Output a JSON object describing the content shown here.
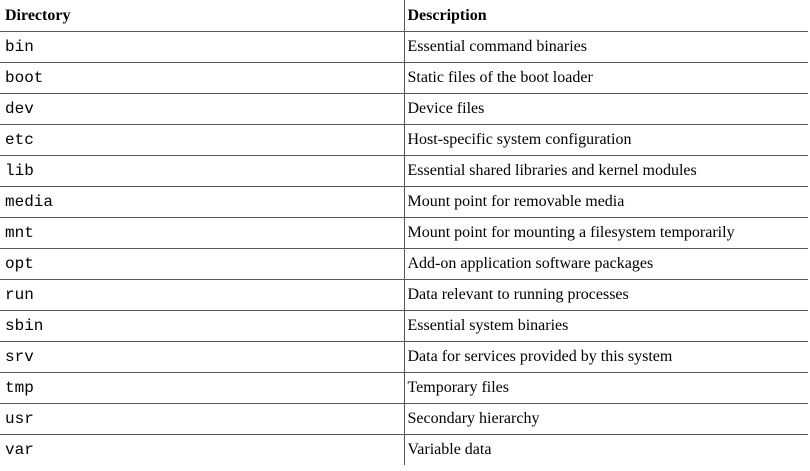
{
  "table": {
    "headers": {
      "directory": "Directory",
      "description": "Description"
    },
    "rows": [
      {
        "directory": "bin",
        "description": "Essential command binaries"
      },
      {
        "directory": "boot",
        "description": "Static files of the boot loader"
      },
      {
        "directory": "dev",
        "description": "Device files"
      },
      {
        "directory": "etc",
        "description": "Host-specific system configuration"
      },
      {
        "directory": "lib",
        "description": "Essential shared libraries and kernel modules"
      },
      {
        "directory": "media",
        "description": "Mount point for removable media"
      },
      {
        "directory": "mnt",
        "description": "Mount point for mounting a filesystem temporarily"
      },
      {
        "directory": "opt",
        "description": "Add-on application software packages"
      },
      {
        "directory": "run",
        "description": "Data relevant to running processes"
      },
      {
        "directory": "sbin",
        "description": "Essential system binaries"
      },
      {
        "directory": "srv",
        "description": "Data for services provided by this system"
      },
      {
        "directory": "tmp",
        "description": "Temporary files"
      },
      {
        "directory": "usr",
        "description": "Secondary hierarchy"
      },
      {
        "directory": "var",
        "description": "Variable data"
      }
    ]
  }
}
